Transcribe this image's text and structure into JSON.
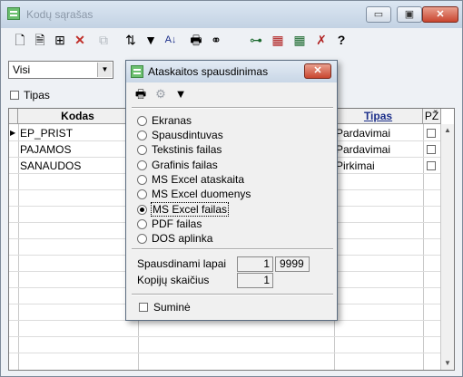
{
  "window": {
    "title": "Kodų sąrašas"
  },
  "window_controls": {
    "minimize": "▭",
    "maximize": "▣",
    "close": "✕"
  },
  "filter": {
    "selected": "Visi"
  },
  "checkbox_tipas": {
    "label": "Tipas"
  },
  "table": {
    "headers": [
      "Kodas",
      "Tipas",
      "PŽ"
    ],
    "rows": [
      {
        "kodas": "EP_PRIST",
        "tipas": "Pardavimai"
      },
      {
        "kodas": "PAJAMOS",
        "tipas": "Pardavimai"
      },
      {
        "kodas": "SANAUDOS",
        "tipas": "Pirkimai"
      }
    ]
  },
  "dialog": {
    "title": "Ataskaitos spausdinimas",
    "close": "✕",
    "options": [
      {
        "label": "Ekranas",
        "selected": false
      },
      {
        "label": "Spausdintuvas",
        "selected": false
      },
      {
        "label": "Tekstinis failas",
        "selected": false
      },
      {
        "label": "Grafinis failas",
        "selected": false
      },
      {
        "label": "MS Excel ataskaita",
        "selected": false
      },
      {
        "label": "MS Excel duomenys",
        "selected": false
      },
      {
        "label": "MS Excel failas",
        "selected": true
      },
      {
        "label": "PDF failas",
        "selected": false
      },
      {
        "label": "DOS aplinka",
        "selected": false
      }
    ],
    "pages_label": "Spausdinami lapai",
    "pages_from": "1",
    "pages_to": "9999",
    "copies_label": "Kopijų skaičius",
    "copies": "1",
    "sumine_label": "Suminė"
  },
  "icons": {
    "toolbar": [
      "new-doc-icon",
      "edit-doc-icon",
      "tree-icon",
      "delete-icon",
      "copy-icon",
      "sort-icon",
      "filter-icon",
      "sort-az-icon",
      "printer-icon",
      "binoculars-icon",
      "hierarchy-icon",
      "group-icon",
      "group-add-icon",
      "tools-icon",
      "help-icon"
    ],
    "dialog_toolbar": [
      "printer-icon",
      "setup-icon",
      "filter-icon"
    ]
  },
  "colors": {
    "accent_green": "#6cc070",
    "close_red": "#c9462f",
    "tipas_header": "#1c2f8a"
  }
}
